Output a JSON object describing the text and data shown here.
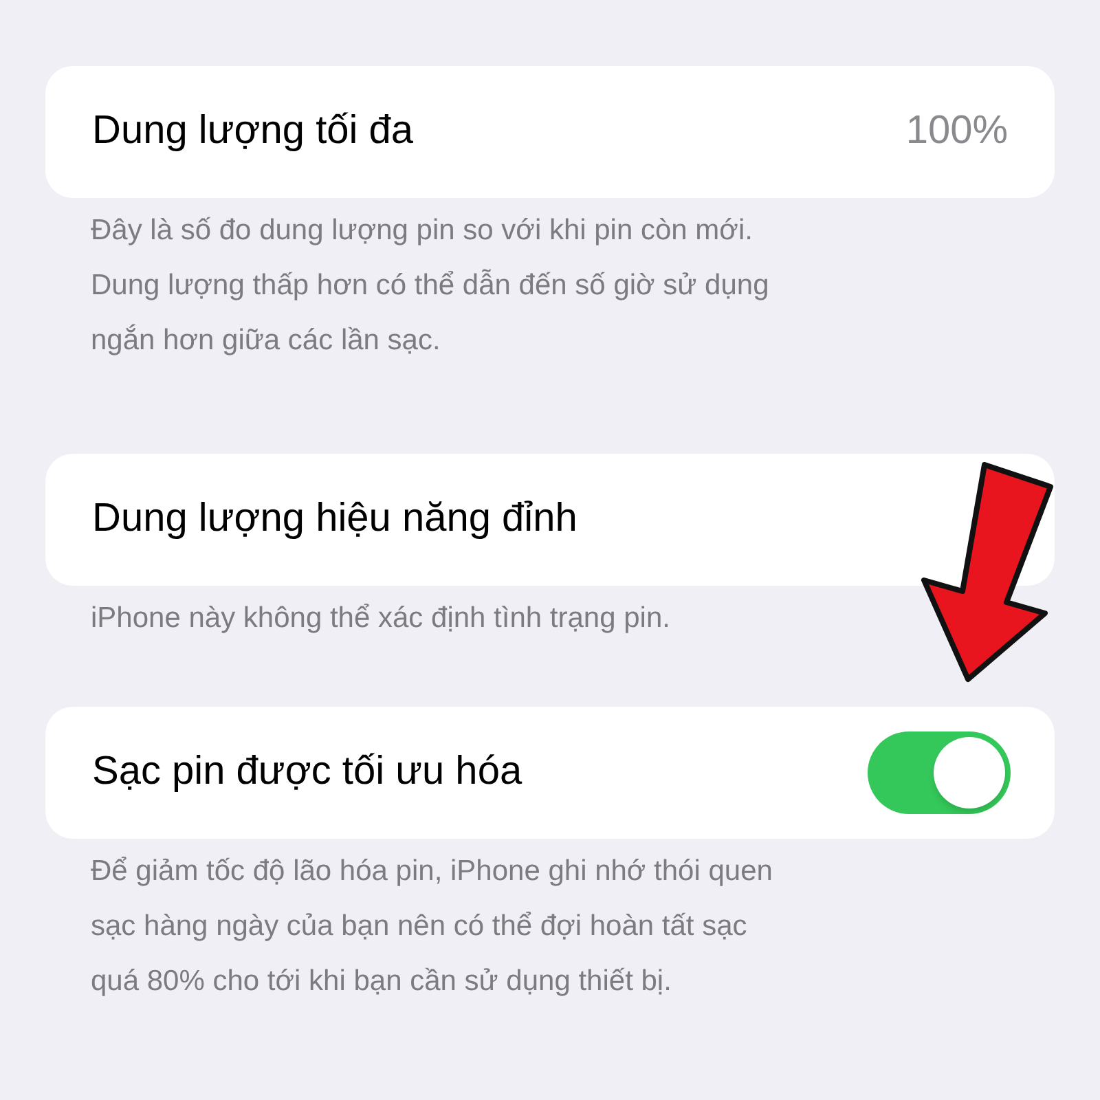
{
  "sections": [
    {
      "kind": "value",
      "label": "Dung lượng tối đa",
      "value": "100%",
      "footer": "Đây là số đo dung lượng pin so với khi pin còn mới.\nDung lượng thấp hơn có thể dẫn đến số giờ sử dụng\nngắn hơn giữa các lần sạc."
    },
    {
      "kind": "plain",
      "label": "Dung lượng hiệu năng đỉnh",
      "footer": "iPhone này không thể xác định tình trạng pin."
    },
    {
      "kind": "toggle",
      "label": "Sạc pin được tối ưu hóa",
      "on": true,
      "footer": "Để giảm tốc độ lão hóa pin, iPhone ghi nhớ thói quen\nsạc hàng ngày của bạn nên có thể đợi hoàn tất sạc\nquá 80% cho tới khi bạn cần sử dụng thiết bị."
    }
  ]
}
